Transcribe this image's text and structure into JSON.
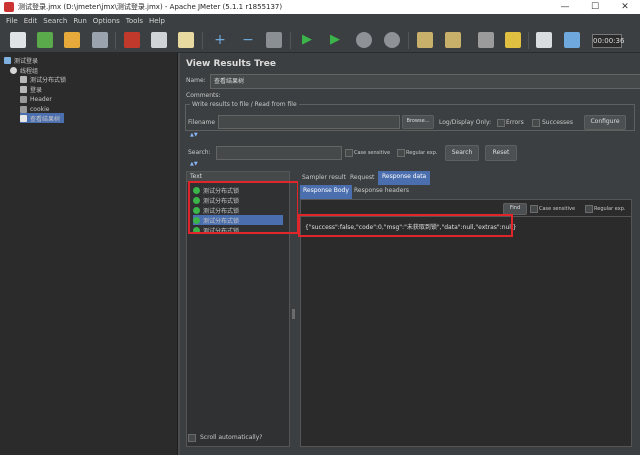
{
  "window": {
    "title": "测试登录.jmx (D:\\jmeter\\jmx\\测试登录.jmx) - Apache JMeter (5.1.1 r1855137)",
    "minimize_glyph": "—",
    "maximize_glyph": "☐",
    "close_glyph": "✕"
  },
  "menu": [
    "File",
    "Edit",
    "Search",
    "Run",
    "Options",
    "Tools",
    "Help"
  ],
  "toolbar": {
    "timer": "00:00:36"
  },
  "tree": {
    "items": [
      {
        "label": "测试登录",
        "icon": "flask-icon"
      },
      {
        "label": "线程组",
        "icon": "gear-icon"
      },
      {
        "label": "测试分布式锁",
        "icon": "sampler-icon"
      },
      {
        "label": "登录",
        "icon": "sampler-icon"
      },
      {
        "label": "Header",
        "icon": "config-icon"
      },
      {
        "label": "cookie",
        "icon": "config-icon"
      },
      {
        "label": "查看结果树",
        "icon": "listener-icon"
      }
    ]
  },
  "panel": {
    "title": "View Results Tree",
    "name_label": "Name:",
    "name_value": "查看结果树",
    "comments_label": "Comments:",
    "group_title": "Write results to file / Read from file",
    "filename_label": "Filename",
    "browse_label": "Browse...",
    "logdisplay_label": "Log/Display Only:",
    "errors_label": "Errors",
    "successes_label": "Successes",
    "configure_label": "Configure",
    "search_label": "Search:",
    "case_sensitive_label": "Case sensitive",
    "regex_label": "Regular exp.",
    "search_btn": "Search",
    "reset_btn": "Reset"
  },
  "results": {
    "header": "Text",
    "items": [
      "测试分布式锁",
      "测试分布式锁",
      "测试分布式锁",
      "测试分布式锁",
      "测试分布式锁"
    ],
    "selected_index": 3,
    "scroll_auto_label": "Scroll automatically?"
  },
  "detail": {
    "tabs": [
      "Sampler result",
      "Request",
      "Response data"
    ],
    "active_tab": 2,
    "subtabs": [
      "Response Body",
      "Response headers"
    ],
    "find_btn": "Find",
    "case_sensitive_label": "Case sensitive",
    "regex_label": "Regular exp.",
    "body": "{\"success\":false,\"code\":0,\"msg\":\"未获取到锁\",\"data\":null,\"extras\":null}"
  },
  "colors": {
    "accent": "#4b6eaf",
    "highlight_box": "#e0262a"
  }
}
